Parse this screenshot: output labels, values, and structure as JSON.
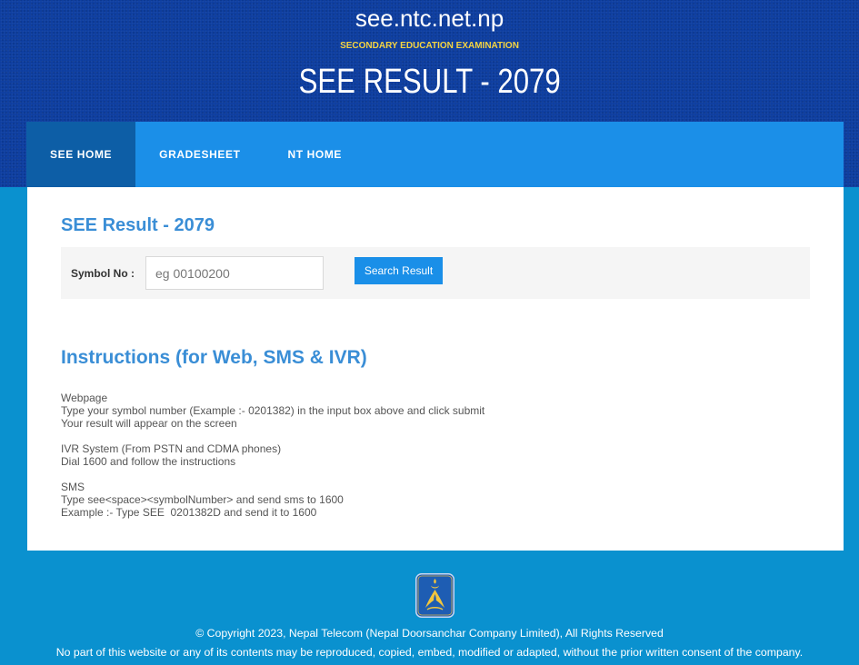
{
  "header": {
    "site": "see.ntc.net.np",
    "subtitle": "SECONDARY EDUCATION EXAMINATION",
    "title": "SEE RESULT - 2079"
  },
  "nav": {
    "items": [
      {
        "label": "SEE HOME",
        "active": true
      },
      {
        "label": "GRADESHEET",
        "active": false
      },
      {
        "label": "NT HOME",
        "active": false
      }
    ]
  },
  "main": {
    "heading": "SEE Result - 2079",
    "form": {
      "symbol_label": "Symbol No :",
      "symbol_value": "",
      "symbol_placeholder": "eg 00100200",
      "search_label": "Search Result"
    },
    "instructions": {
      "heading": "Instructions (for Web, SMS & IVR)",
      "sections": [
        {
          "title": "Webpage",
          "lines": [
            "Type your symbol number (Example :- 0201382) in the input box above and click submit",
            "Your result will appear on the screen"
          ]
        },
        {
          "title": "IVR System (From PSTN and CDMA phones)",
          "lines": [
            "Dial 1600 and follow the instructions"
          ]
        },
        {
          "title": "SMS",
          "lines": [
            "Type see<space><symbolNumber> and send sms to 1600",
            "Example :- Type SEE  0201382D and send it to 1600"
          ]
        }
      ]
    }
  },
  "footer": {
    "logo_icon": "ntc-logo-icon",
    "copyright": "© Copyright 2023, Nepal Telecom (Nepal Doorsanchar Company Limited), All Rights Reserved",
    "notice": "No part of this website or any of its contents may be reproduced, copied, embed, modified or adapted, without the prior written consent of the company."
  },
  "colors": {
    "header_bg": "#0b3c9f",
    "page_bg": "#0a91cf",
    "nav_bg": "#1b8fe8",
    "nav_active_bg": "#0d5ea6",
    "accent_text": "#3a8ed6",
    "subtitle": "#f5d442",
    "button_bg": "#1a8fe8",
    "form_bg": "#f5f5f5",
    "body_text": "#555555"
  }
}
